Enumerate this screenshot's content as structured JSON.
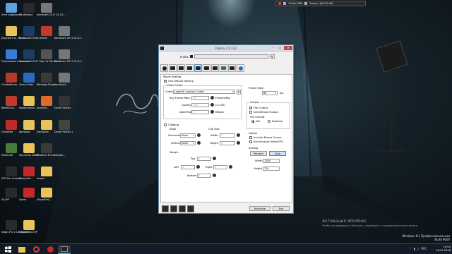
{
  "capture_bar": {
    "resolution": "1920x1080",
    "status": "Запись [00:03:44]"
  },
  "desktop_icons": [
    {
      "label": "Этот компьютер",
      "color": "#5aa2e0"
    },
    {
      "label": "CS Warface",
      "color": "#2a2a2a"
    },
    {
      "label": "bandicam 2017-01-02...",
      "color": "#777777"
    },
    {
      "label": "Документы - Ярлык",
      "color": "#e8c45a"
    },
    {
      "label": "Cinema4D R18",
      "color": "#1c3c66"
    },
    {
      "label": "CCleaner",
      "color": "#c23a2a"
    },
    {
      "label": "bandicam 2017-01-02...",
      "color": "#777777"
    },
    {
      "label": "Программы и компон...",
      "color": "#3a7bd5"
    },
    {
      "label": "Cinema4D R19",
      "color": "#1c3c66"
    },
    {
      "label": "7 Days to Die Alpha",
      "color": "#555555"
    },
    {
      "label": "bandicam 2017-01-02...",
      "color": "#777777"
    },
    {
      "label": "CombatArms",
      "color": "#b33a2a"
    },
    {
      "label": "Garry's Mod",
      "color": "#2a6ac0"
    },
    {
      "label": "Windows Player",
      "color": "#3a3a3a"
    },
    {
      "label": "bandicam",
      "color": "#777777"
    },
    {
      "label": "BattleCam...",
      "color": "#c23a2a"
    },
    {
      "label": "Новая папка",
      "color": "#e8c45a"
    },
    {
      "label": "Audacity",
      "color": "#e06a2a"
    },
    {
      "label": "Dead Frontier",
      "color": "#333333"
    },
    {
      "label": "GameNet",
      "color": "#c22a2a"
    },
    {
      "label": "фотошоп",
      "color": "#e8c45a"
    },
    {
      "label": "SandyBox",
      "color": "#e8c45a"
    },
    {
      "label": "Dead Frontier 2",
      "color": "#444444"
    },
    {
      "label": "Minecraft",
      "color": "#4a7a3a"
    },
    {
      "label": "эмулятор GENO",
      "color": "#e8c45a"
    },
    {
      "label": "Resident Evil Biohazar...",
      "color": "#3a3a3a"
    },
    {
      "label": "GTA San Andreas",
      "color": "#2a2a2a"
    },
    {
      "label": "OmmyYid...",
      "color": "#c22a2a"
    },
    {
      "label": "image",
      "color": "#e8c45a"
    },
    {
      "label": "SA-MP",
      "color": "#2a2a2a"
    },
    {
      "label": "Opera",
      "color": "#c22a2a"
    },
    {
      "label": "[RapidFire]...",
      "color": "#e8c45a"
    },
    {
      "label": "Vegas Pro 13.0 (64-bit)",
      "color": "#2a2a2a"
    },
    {
      "label": "Видео МАСТЕР",
      "color": "#e8c45a"
    }
  ],
  "window": {
    "title": "Dxtory 2.0.122",
    "profile_label": "Profile",
    "movie_setting": "Movie Setting",
    "use_default_setting": "Use Default Setting",
    "video_codec_caption": "Video Codec",
    "codec_label": "Codec",
    "codec_value": "Lagarith Lossless Codec",
    "keyframe_label": "Key Frame Rate",
    "keyframe_value": "15",
    "keyframe_unit": "Frames/Key",
    "quality_label": "Quality",
    "quality_value": "100",
    "quality_unit": "(0-100)",
    "datarate_label": "Data Rate",
    "datarate_value": "0",
    "datarate_unit": "KB/sec",
    "frame_rate_caption": "Frame Rate",
    "frame_rate_value": "60",
    "fps_label": "fps",
    "output_caption": "Output",
    "file_output": "File Output",
    "directshow_output": "DirectShow Output",
    "file_format_caption": "File Format",
    "avi_label": "AVI",
    "rawcap_label": "RawCap",
    "option_caption": "Option",
    "include_mouse": "Include Mouse Cursor",
    "sync_fps": "Synchronize Video FPS",
    "scaling_caption": "Scaling",
    "percent_btn": "Percent",
    "size_btn": "Size",
    "width_label": "Width",
    "width_value": "1280",
    "height_label": "Height",
    "height_value": "720",
    "clipping_label": "Clipping",
    "align_caption": "Align",
    "horizontal_label": "Horizontal",
    "horizontal_value": "None",
    "vertical_label": "Vertical",
    "vertical_value": "None",
    "clipsize_caption": "Clip Size",
    "clip_width_label": "Width",
    "clip_width_value": "0",
    "clip_height_label": "Height",
    "clip_height_value": "0",
    "margin_caption": "Margin",
    "top_label": "Top",
    "top_value": "0",
    "left_label": "Left",
    "left_value": "0",
    "right_label": "Right",
    "right_value": "0",
    "bottom_label": "Bottom",
    "bottom_value": "0",
    "minimize_btn": "Minimize",
    "exit_btn": "Exit"
  },
  "taskbar": {
    "time": "19:04",
    "date": "28.01.2018",
    "lang": "РУС"
  },
  "watermark": {
    "title": "Активация Windows",
    "text": "Чтобы активировать Windows, перейдите к параметрам компьютера.",
    "edition": "Windows 8.1 Профессиональная",
    "build": "Build 9600"
  },
  "colors": {
    "accent": "#3a86d4",
    "close": "#c74545",
    "taskbar": "#141c28"
  }
}
